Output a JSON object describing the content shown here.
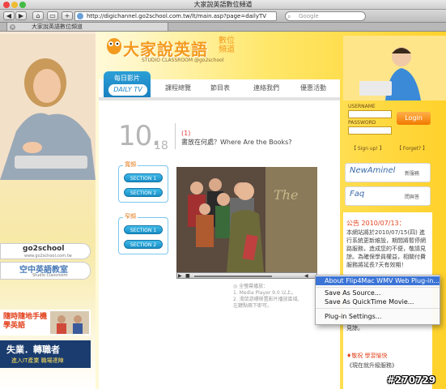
{
  "window": {
    "title": "大家說英語數位頻道"
  },
  "toolbar": {
    "back": "◀",
    "forward": "▶",
    "home": "⌂",
    "bookmark": "▭",
    "add": "+",
    "url": "http://digichannel.go2school.com.tw/lt/main.asp?page=dailyTV",
    "search_placeholder": "Google"
  },
  "tab": {
    "title": "大家說英語數位頻道"
  },
  "site": {
    "logo_main": "大家說英語",
    "logo_sub": "數位頻道",
    "logo_small": "STUDIO CLASSROOM @go2school"
  },
  "nav": {
    "active": "每日影片",
    "active_sub": "DAILY TV",
    "items": [
      "課程總覽",
      "節目表",
      "連絡我們",
      "優惠活動"
    ]
  },
  "lesson": {
    "day": "10.",
    "month": "18",
    "number": "(1)",
    "title": "書放在何處？Where Are the Books?"
  },
  "sections": {
    "group1_label": "寬頻",
    "group2_label": "窄頻",
    "btn1": "SECTION 1",
    "btn2": "SECTION 2"
  },
  "player_notes": {
    "line0": "◎ 全螢幕播放：",
    "line1": "1. Media Player 9.0 以上。",
    "line2": "2. 滑鼠游標移置影片播放區域,",
    "line3": "左鍵點兩下即可。"
  },
  "left": {
    "go2school": "go2school",
    "go2school_url": "www.go2school.com.tw",
    "studio": "空中英語教室",
    "studio_sub": "Studio Classroom",
    "ad1": "隨時隨地手機學英語",
    "ad2_line1": "失業．轉職者",
    "ad2_line2": "進入IT產業 職場達陣"
  },
  "login": {
    "username_label": "USERNAME",
    "password_label": "PASSWORD",
    "button": "Login",
    "signup": "【 Sign up! 】",
    "forgot": "【 Forget? 】"
  },
  "right_buttons": {
    "news_label": "NewAminel",
    "news_cn": "新服務",
    "faq_label": "Faq",
    "faq_cn": "問與答"
  },
  "announce": {
    "title": "公告 2010/07/13：",
    "body": "本網站將於2010/07/15(四) 進行系統更新維設，期間將暫停網路服務，造成您的不便，敬請見諒。為確保學員權益，相關付費服務將延長7天有效期！",
    "tail": "見諒。",
    "footer1": "♦敬祝 學習愉快",
    "footer2": "《現在就升級服務》"
  },
  "context_menu": {
    "item1": "About Flip4Mac WMV Web Plug-in...",
    "item2": "Save As Source...",
    "item3": "Save As QuickTime Movie...",
    "item4": "Plug-in Settings..."
  },
  "watermark": "#270729"
}
